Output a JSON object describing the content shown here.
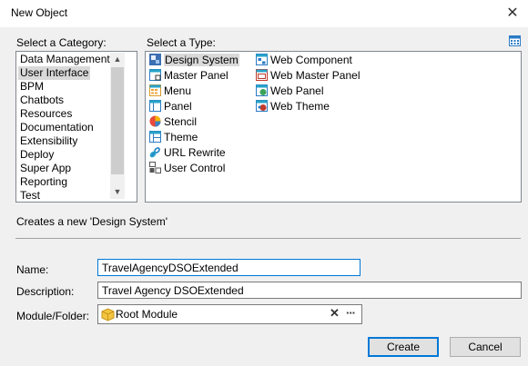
{
  "window": {
    "title": "New Object",
    "close_glyph": "✕"
  },
  "category": {
    "label": "Select a Category:",
    "items": [
      "Data Management",
      "User Interface",
      "BPM",
      "Chatbots",
      "Resources",
      "Documentation",
      "Extensibility",
      "Deploy",
      "Super App",
      "Reporting",
      "Test"
    ],
    "selected": "User Interface"
  },
  "type": {
    "label": "Select a Type:",
    "items": [
      {
        "label": "Design System",
        "icon": "design-system-icon"
      },
      {
        "label": "Master Panel",
        "icon": "master-panel-icon"
      },
      {
        "label": "Menu",
        "icon": "menu-icon"
      },
      {
        "label": "Panel",
        "icon": "panel-icon"
      },
      {
        "label": "Stencil",
        "icon": "stencil-icon"
      },
      {
        "label": "Theme",
        "icon": "theme-icon"
      },
      {
        "label": "URL Rewrite",
        "icon": "url-rewrite-icon"
      },
      {
        "label": "User Control",
        "icon": "user-control-icon"
      },
      {
        "label": "Web Component",
        "icon": "web-component-icon"
      },
      {
        "label": "Web Master Panel",
        "icon": "web-master-panel-icon"
      },
      {
        "label": "Web Panel",
        "icon": "web-panel-icon"
      },
      {
        "label": "Web Theme",
        "icon": "web-theme-icon"
      }
    ],
    "selected": "Design System"
  },
  "description_text": "Creates a new 'Design System'",
  "form": {
    "name_label": "Name:",
    "name_value": "TravelAgencyDSOExtended",
    "description_label": "Description:",
    "description_value": "Travel Agency DSOExtended",
    "module_label": "Module/Folder:",
    "module_value": "Root Module",
    "clear_glyph": "✕",
    "browse_glyph": "···"
  },
  "buttons": {
    "create": "Create",
    "cancel": "Cancel"
  },
  "colors": {
    "accent": "#0078d7",
    "selection": "#d9d9d9"
  }
}
